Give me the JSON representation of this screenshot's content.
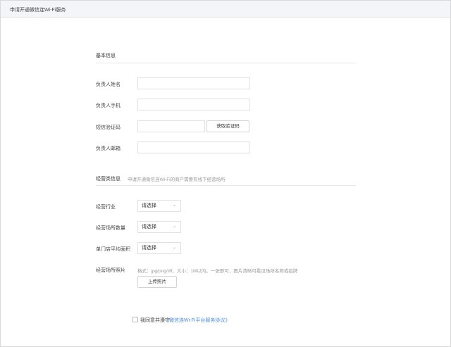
{
  "header": {
    "title": "申请开通微信连Wi-Fi服务"
  },
  "basic": {
    "title": "基本信息",
    "name_label": "负责人姓名",
    "phone_label": "负责人手机",
    "code_label": "短信验证码",
    "get_code_button": "获取验证码",
    "email_label": "负责人邮箱",
    "name_value": "",
    "phone_value": "",
    "code_value": "",
    "email_value": ""
  },
  "business": {
    "title": "经营类信息",
    "description": "申请开通微信连Wi-Fi的商户需要有线下经营场所",
    "industry_label": "经营行业",
    "industry_value": "请选择",
    "venue_count_label": "经营场所数量",
    "venue_count_value": "请选择",
    "store_area_label": "单门店平均面积",
    "store_area_value": "请选择",
    "photo_label": "经营场所照片",
    "photo_hint": "格式：jpg/png/tiff，大小：1M以内。一张即可，图片清晰可看见场所名称或招牌",
    "upload_button": "上传照片"
  },
  "agreement": {
    "text": "我同意并遵守",
    "link": "《微信连Wi-Fi平台服务协议》"
  }
}
